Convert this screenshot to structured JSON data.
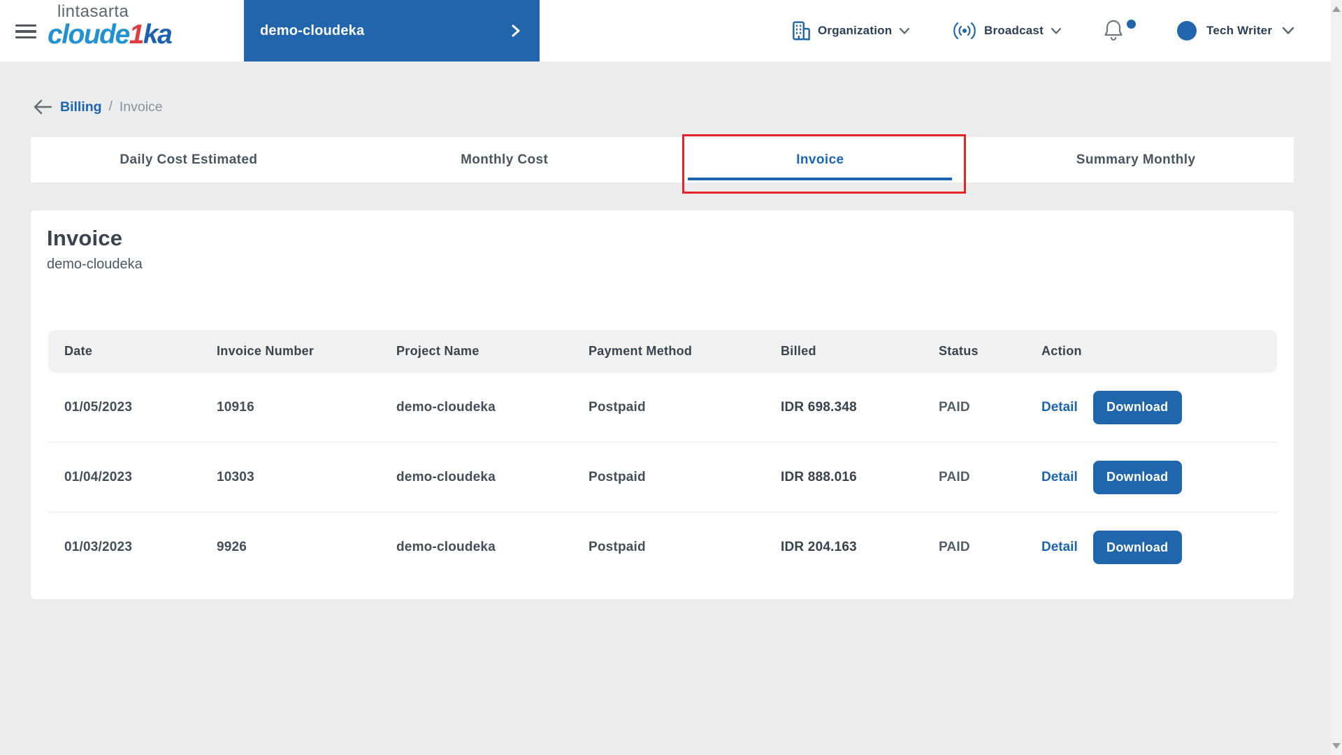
{
  "brand": {
    "line1": "lintasarta",
    "word_part1": "cloude",
    "word_accent": "1",
    "word_part2": "ka"
  },
  "header": {
    "project": {
      "label": "demo-cloudeka"
    },
    "organization": {
      "label": "Organization"
    },
    "broadcast": {
      "label": "Broadcast"
    },
    "user": {
      "name": "Tech Writer"
    },
    "notification_badge": true
  },
  "breadcrumb": {
    "parent": "Billing",
    "separator": "/",
    "current": "Invoice"
  },
  "tabs": [
    {
      "label": "Daily Cost Estimated",
      "active": false
    },
    {
      "label": "Monthly Cost",
      "active": false
    },
    {
      "label": "Invoice",
      "active": true
    },
    {
      "label": "Summary Monthly",
      "active": false
    }
  ],
  "page": {
    "title": "Invoice",
    "subtitle": "demo-cloudeka"
  },
  "table": {
    "columns": [
      "Date",
      "Invoice Number",
      "Project Name",
      "Payment Method",
      "Billed",
      "Status",
      "Action"
    ],
    "rows": [
      {
        "date": "01/05/2023",
        "invoice_number": "10916",
        "project_name": "demo-cloudeka",
        "payment_method": "Postpaid",
        "billed": "IDR 698.348",
        "status": "PAID",
        "detail_label": "Detail",
        "download_label": "Download"
      },
      {
        "date": "01/04/2023",
        "invoice_number": "10303",
        "project_name": "demo-cloudeka",
        "payment_method": "Postpaid",
        "billed": "IDR 888.016",
        "status": "PAID",
        "detail_label": "Detail",
        "download_label": "Download"
      },
      {
        "date": "01/03/2023",
        "invoice_number": "9926",
        "project_name": "demo-cloudeka",
        "payment_method": "Postpaid",
        "billed": "IDR 204.163",
        "status": "PAID",
        "detail_label": "Detail",
        "download_label": "Download"
      }
    ]
  },
  "icons": {
    "menu": "hamburger-icon",
    "project_chevron": "chevron-right-icon",
    "organization": "building-icon",
    "broadcast": "broadcast-icon",
    "notifications": "bell-icon",
    "user_chevron": "chevron-down-icon",
    "back": "arrow-left-icon"
  },
  "colors": {
    "primary_blue": "#2166ac",
    "link_blue": "#1a65b2",
    "annotation_red": "#e4232b",
    "page_background": "#ececec",
    "table_header_bg": "#f1f1f2",
    "logo_red": "#e03b40"
  }
}
